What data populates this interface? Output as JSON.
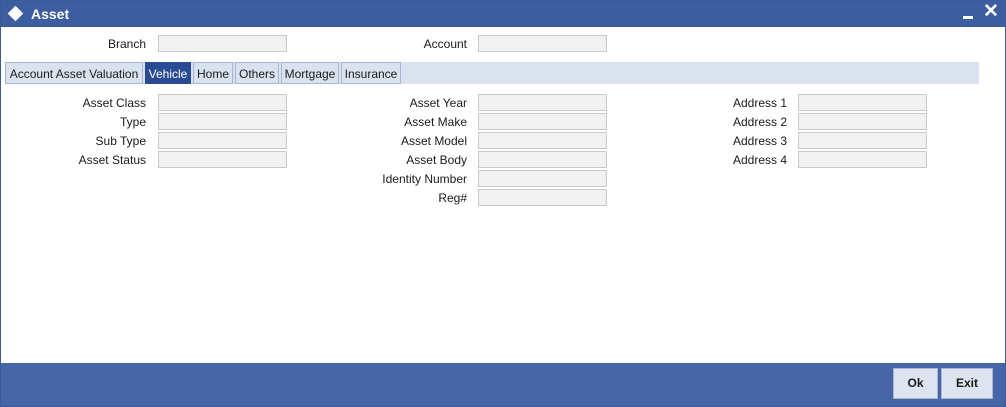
{
  "window": {
    "title": "Asset",
    "minimize_glyph": "−",
    "close_glyph": "✕"
  },
  "header": {
    "branch_label": "Branch",
    "branch_value": "",
    "account_label": "Account",
    "account_value": ""
  },
  "tabs": [
    {
      "label": "Account Asset Valuation",
      "active": false
    },
    {
      "label": "Vehicle",
      "active": true
    },
    {
      "label": "Home",
      "active": false
    },
    {
      "label": "Others",
      "active": false
    },
    {
      "label": "Mortgage",
      "active": false
    },
    {
      "label": "Insurance",
      "active": false
    }
  ],
  "vehicle": {
    "asset_class_label": "Asset Class",
    "asset_class_value": "",
    "type_label": "Type",
    "type_value": "",
    "sub_type_label": "Sub Type",
    "sub_type_value": "",
    "asset_status_label": "Asset Status",
    "asset_status_value": "",
    "asset_year_label": "Asset Year",
    "asset_year_value": "",
    "asset_make_label": "Asset Make",
    "asset_make_value": "",
    "asset_model_label": "Asset Model",
    "asset_model_value": "",
    "asset_body_label": "Asset Body",
    "asset_body_value": "",
    "identity_number_label": "Identity Number",
    "identity_number_value": "",
    "reg_label": "Reg#",
    "reg_value": "",
    "address1_label": "Address 1",
    "address1_value": "",
    "address2_label": "Address 2",
    "address2_value": "",
    "address3_label": "Address 3",
    "address3_value": "",
    "address4_label": "Address 4",
    "address4_value": ""
  },
  "footer": {
    "ok_label": "Ok",
    "exit_label": "Exit"
  },
  "colors": {
    "titlebar": "#3c5da0",
    "tab_active": "#284c93",
    "tabstrip": "#dbe2ef",
    "footer": "#4766a8",
    "field_bg": "#f1f1f1"
  }
}
